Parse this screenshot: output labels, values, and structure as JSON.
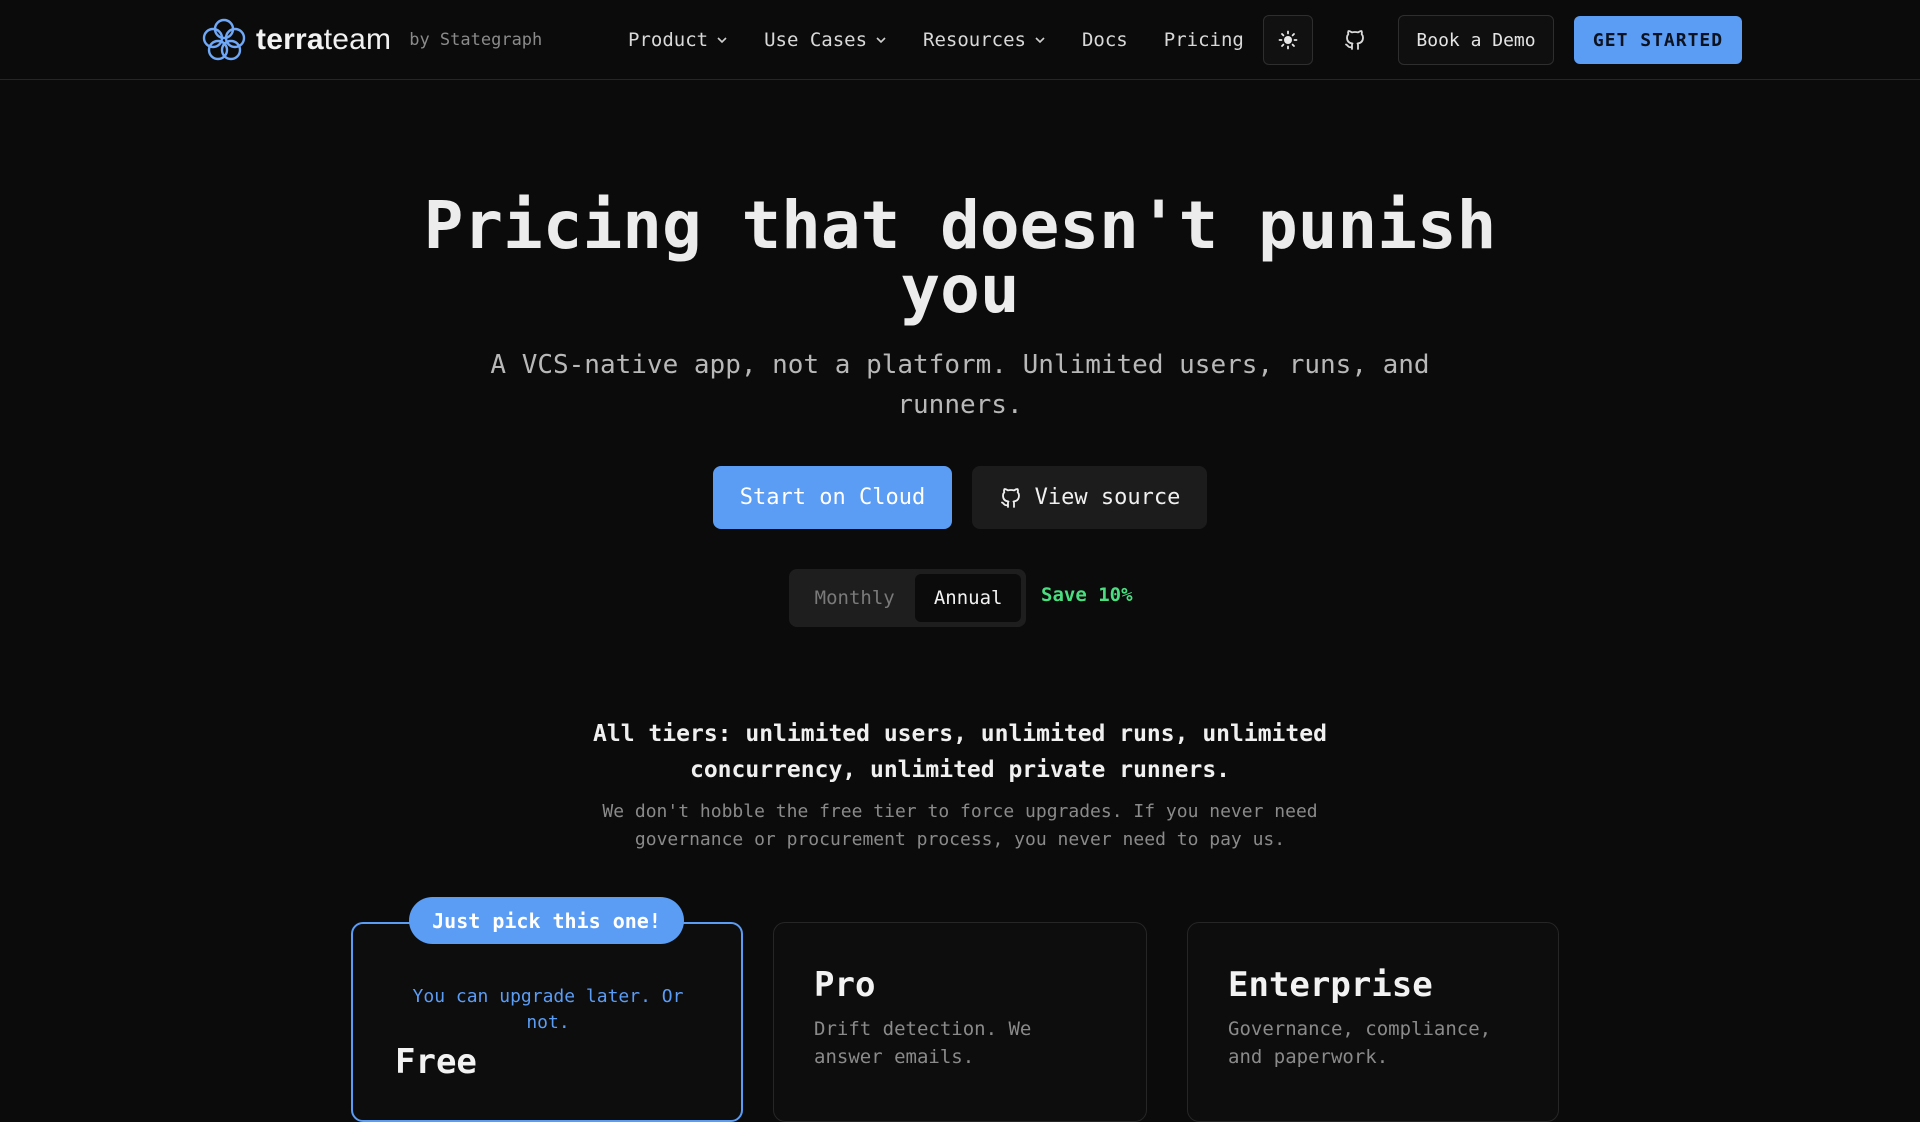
{
  "brand": {
    "name_bold": "terra",
    "name_light": "team",
    "by": "by Stategraph",
    "accent": "#5b9cf5",
    "success": "#4ade80",
    "background": "#0b0b0b"
  },
  "nav": {
    "items": [
      {
        "label": "Product",
        "has_dropdown": true
      },
      {
        "label": "Use Cases",
        "has_dropdown": true
      },
      {
        "label": "Resources",
        "has_dropdown": true
      },
      {
        "label": "Docs",
        "has_dropdown": false
      },
      {
        "label": "Pricing",
        "has_dropdown": false
      }
    ],
    "theme_icon": "sun-icon",
    "github_icon": "github-icon",
    "book_demo": "Book a Demo",
    "get_started": "GET STARTED"
  },
  "hero": {
    "title_line1": "Pricing that doesn't punish",
    "title_line2": "you",
    "subtitle_line1": "A VCS-native app, not a platform. Unlimited users, runs, and",
    "subtitle_line2": "runners.",
    "primary_cta": "Start on Cloud",
    "secondary_cta": "View source"
  },
  "billing": {
    "options": [
      "Monthly",
      "Annual"
    ],
    "selected": "Annual",
    "save_note": "Save 10%"
  },
  "tiers": {
    "headline_line1": "All tiers: unlimited users, unlimited runs, unlimited",
    "headline_line2": "concurrency, unlimited private runners.",
    "note_line1": "We don't hobble the free tier to force upgrades. If you never need",
    "note_line2": "governance or procurement process, you never need to pay us."
  },
  "plans": {
    "free": {
      "badge": "Just pick this one!",
      "note_line1": "You can upgrade later. Or",
      "note_line2": "not.",
      "title": "Free"
    },
    "pro": {
      "title": "Pro",
      "desc_line1": "Drift detection. We",
      "desc_line2": "answer emails."
    },
    "enterprise": {
      "title": "Enterprise",
      "desc_line1": "Governance, compliance,",
      "desc_line2": "and paperwork."
    }
  }
}
